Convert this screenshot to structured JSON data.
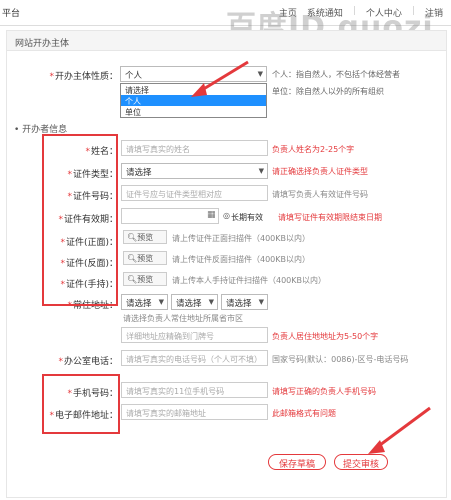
{
  "topbar": {
    "left_text": "平台",
    "nav": [
      "主页",
      "系统通知",
      "个人中心",
      "注销"
    ],
    "watermark": "百度ID guozi"
  },
  "section_title": "网站开办主体",
  "subject_type": {
    "label": "开办主体性质：",
    "value": "个人",
    "hint_line1": "个人：指自然人，不包括个体经营者",
    "hint_line2": "单位：除自然人以外的所有组织",
    "options": [
      "请选择",
      "个人",
      "单位"
    ]
  },
  "owner_section_title": "开办者信息",
  "fields": {
    "name": {
      "label": "姓名：",
      "placeholder": "请填写真实的姓名",
      "error": "负责人姓名为2-25个字"
    },
    "id_type": {
      "label": "证件类型：",
      "value": "请选择",
      "error": "请正确选择负责人证件类型"
    },
    "id_number": {
      "label": "证件号码：",
      "placeholder": "证件号应与证件类型相对应",
      "hint": "请填写负责人有效证件号码"
    },
    "id_validity": {
      "label": "证件有效期：",
      "long_term": "长期有效",
      "error": "请填写证件有效期限结束日期"
    },
    "id_front": {
      "label": "证件(正面)：",
      "button": "预览",
      "hint": "请上传证件正面扫描件（400KB以内）"
    },
    "id_back": {
      "label": "证件(反面)：",
      "button": "预览",
      "hint": "请上传证件反面扫描件（400KB以内）"
    },
    "id_hand": {
      "label": "证件(手持)：",
      "button": "预览",
      "hint": "请上传本人手持证件扫描件（400KB以内）"
    },
    "address": {
      "label": "常住地址：",
      "select1": "请选择",
      "select2": "请选择",
      "select3": "请选择",
      "region_hint": "请选择负责人常住地址所属省市区",
      "detail_placeholder": "详细地址应精确到门牌号",
      "error": "负责人居住地地址为5-50个字"
    },
    "office_phone": {
      "label": "办公室电话：",
      "placeholder": "请填写真实的电话号码（个人可不填）",
      "hint": "国家号码(默认：0086)-区号-电话号码"
    },
    "mobile": {
      "label": "手机号码：",
      "placeholder": "请填写真实的11位手机号码",
      "error": "请填写正确的负责人手机号码"
    },
    "email": {
      "label": "电子邮件地址：",
      "placeholder": "请填写真实的邮箱地址",
      "error": "此邮箱格式有问题"
    }
  },
  "buttons": {
    "save": "保存草稿",
    "submit": "提交审核"
  },
  "colors": {
    "accent_red": "#e4393c",
    "selected_blue": "#1e90ff"
  }
}
